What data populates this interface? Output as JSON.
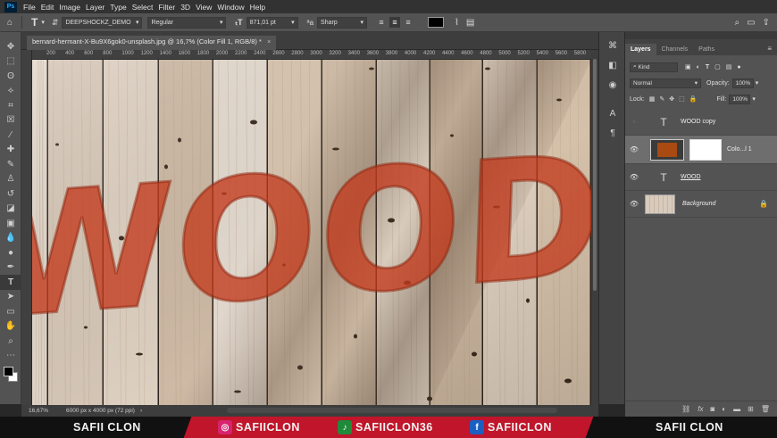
{
  "menu": {
    "logo": "Ps",
    "items": [
      "File",
      "Edit",
      "Image",
      "Layer",
      "Type",
      "Select",
      "Filter",
      "3D",
      "View",
      "Window",
      "Help"
    ]
  },
  "options": {
    "font_family": "DEEPSHOCKZ_DEMO",
    "font_style": "Regular",
    "font_size": "871,01 pt",
    "antialias": "Sharp",
    "text_color": "#000000"
  },
  "document": {
    "tab_title": "bernard-hermant-X-Bu9X6gok0-unsplash.jpg @ 16,7% (Color Fill 1, RGB/8) *",
    "close_symbol": "×",
    "ruler_ticks": [
      "200",
      "400",
      "600",
      "800",
      "1000",
      "1200",
      "1400",
      "1600",
      "1800",
      "2000",
      "2200",
      "2400",
      "2600",
      "2800",
      "3000",
      "3200",
      "3400",
      "3600",
      "3800",
      "4000",
      "4200",
      "4400",
      "4600",
      "4800",
      "5000",
      "5200",
      "5400",
      "5600",
      "5800"
    ],
    "canvas_text": "WOOD",
    "wood_color": "#dcd0c3",
    "paint_color": "#c13a1c"
  },
  "status": {
    "zoom": "16,67%",
    "dimensions": "6000 px x 4000 px (72 ppi)"
  },
  "layers_panel": {
    "tabs": [
      "Layers",
      "Channels",
      "Paths"
    ],
    "kind": "Kind",
    "blend_mode": "Normal",
    "opacity_label": "Opacity:",
    "opacity": "100%",
    "lock_label": "Lock:",
    "fill_label": "Fill:",
    "fill": "100%",
    "layers": [
      {
        "name": "WOOD copy",
        "type": "text",
        "visible": false,
        "selected": false
      },
      {
        "name": "Colo...l 1",
        "type": "fill",
        "visible": true,
        "selected": true,
        "swatch": "#a84a12"
      },
      {
        "name": "WOOD",
        "type": "text",
        "visible": true,
        "selected": false
      },
      {
        "name": "Background",
        "type": "image",
        "visible": true,
        "selected": false
      }
    ]
  },
  "banner": {
    "left_name": "SAFII CLON",
    "instagram": "SAFIICLON",
    "tiktok": "SAFIICLON36",
    "facebook": "SAFIICLON",
    "right_name": "SAFII CLON"
  }
}
